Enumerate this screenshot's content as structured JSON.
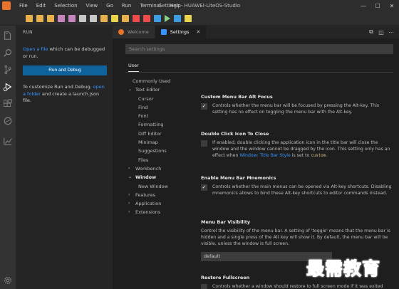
{
  "titlebar": {
    "menu": [
      "File",
      "Edit",
      "Selection",
      "View",
      "Go",
      "Run",
      "Terminal",
      "Help"
    ],
    "title": "Settings - HUAWEI-LiteOS-Studio",
    "controls": {
      "minimize": "—",
      "maximize": "☐",
      "close": "✕"
    }
  },
  "toolbar": {
    "icons": [
      {
        "name": "new-file-icon",
        "color": "#e8b04a"
      },
      {
        "name": "open-folder-icon",
        "color": "#e8b04a"
      },
      {
        "name": "save-icon",
        "color": "#e8b04a"
      },
      {
        "name": "undo-icon",
        "color": "#c586c0"
      },
      {
        "name": "redo-icon",
        "color": "#c586c0"
      },
      {
        "name": "board-icon",
        "color": "#c8c8c8"
      },
      {
        "name": "config-icon",
        "color": "#c8c8c8"
      },
      {
        "name": "compile-icon",
        "color": "#e8b04a"
      },
      {
        "name": "clean-icon",
        "color": "#e8d44d"
      },
      {
        "name": "burn-icon",
        "color": "#e8b04a"
      },
      {
        "name": "stop-icon",
        "color": "#f14c4c"
      },
      {
        "name": "reset-icon",
        "color": "#f14c4c"
      },
      {
        "name": "debug-icon",
        "color": "#3c9de0"
      },
      {
        "name": "run-icon",
        "color": "#89d185"
      },
      {
        "name": "terminal-icon",
        "color": "#3c9de0"
      },
      {
        "name": "tools-icon",
        "color": "#e8d44d"
      }
    ]
  },
  "activity": {
    "icons": [
      "explorer-icon",
      "search-icon",
      "source-control-icon",
      "run-debug-icon",
      "extensions-icon",
      "remote-icon",
      "stats-icon",
      "manage-gear-icon"
    ]
  },
  "sidebar": {
    "header": "RUN",
    "open_link": "Open a file",
    "open_text": " which can be debugged or run.",
    "run_button": "Run and Debug",
    "customize_text": "To customize Run and Debug, ",
    "open_folder_link": "open a folder",
    "customize_text2": " and create a launch.json file."
  },
  "tabs": [
    {
      "label": "Welcome",
      "active": false,
      "icon_color": "#e8732a"
    },
    {
      "label": "Settings",
      "active": true,
      "icon_color": "#3794ff",
      "close": "✕"
    }
  ],
  "tab_actions": [
    "⧉",
    "◫",
    "⋯"
  ],
  "settings": {
    "search_placeholder": "Search settings",
    "scope_tab": "User",
    "toc": [
      {
        "label": "Commonly Used",
        "indent": 1,
        "chevron": ""
      },
      {
        "label": "Text Editor",
        "indent": 0,
        "chevron": "⌄"
      },
      {
        "label": "Cursor",
        "indent": 2,
        "chevron": ""
      },
      {
        "label": "Find",
        "indent": 2,
        "chevron": ""
      },
      {
        "label": "Font",
        "indent": 2,
        "chevron": ""
      },
      {
        "label": "Formatting",
        "indent": 2,
        "chevron": ""
      },
      {
        "label": "Diff Editor",
        "indent": 2,
        "chevron": ""
      },
      {
        "label": "Minimap",
        "indent": 2,
        "chevron": ""
      },
      {
        "label": "Suggestions",
        "indent": 2,
        "chevron": ""
      },
      {
        "label": "Files",
        "indent": 2,
        "chevron": ""
      },
      {
        "label": "Workbench",
        "indent": 0,
        "chevron": "›"
      },
      {
        "label": "Window",
        "indent": 0,
        "chevron": "⌄",
        "bold": true
      },
      {
        "label": "New Window",
        "indent": 2,
        "chevron": ""
      },
      {
        "label": "Features",
        "indent": 0,
        "chevron": "›"
      },
      {
        "label": "Application",
        "indent": 0,
        "chevron": "›"
      },
      {
        "label": "Extensions",
        "indent": 0,
        "chevron": "›"
      }
    ],
    "items": {
      "custom_menu": {
        "title": "Custom Menu Bar Alt Focus",
        "checked": "✓",
        "desc": "Controls whether the menu bar will be focused by pressing the Alt-key. This setting has no effect on toggling the menu bar with the Alt-key."
      },
      "double_click": {
        "title": "Double Click Icon To Close",
        "checked": "",
        "desc1": "If enabled, double clicking the application icon in the title bar will close the window and the window cannot be dragged by the icon. This setting only has an effect when ",
        "desc_link": "Window: Title Bar Style",
        "desc2": " is set to ",
        "desc_code": "custom",
        "desc3": "."
      },
      "mnemonics": {
        "title": "Enable Menu Bar Mnemonics",
        "checked": "✓",
        "desc": "Controls whether the main menus can be opened via Alt-key shortcuts. Disabling mnemonics allows to bind these Alt-key shortcuts to editor commands instead."
      },
      "visibility": {
        "title": "Menu Bar Visibility",
        "desc": "Control the visibility of the menu bar. A setting of 'toggle' means that the menu bar is hidden and a single press of the Alt key will show it. By default, the menu bar will be visible, unless the window is full screen.",
        "select_value": "default"
      },
      "restore_fullscreen": {
        "title": "Restore Fullscreen",
        "checked": "",
        "desc": "Controls whether a window should restore to full screen mode if it was exited"
      }
    }
  },
  "watermark": "最需教育"
}
